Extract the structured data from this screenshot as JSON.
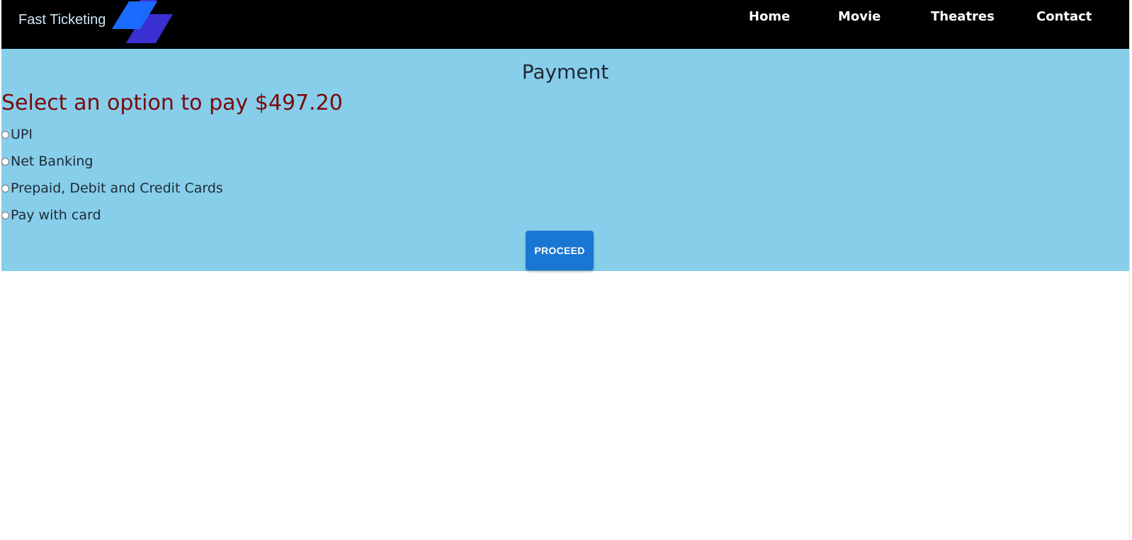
{
  "header": {
    "brand": "Fast Ticketing",
    "nav": {
      "home": "Home",
      "movie": "Movie",
      "theatres": "Theatres",
      "contact": "Contact"
    }
  },
  "payment": {
    "title": "Payment",
    "prompt": "Select an option to pay $497.20",
    "options": [
      {
        "label": "UPI",
        "selected": false
      },
      {
        "label": "Net Banking",
        "selected": false
      },
      {
        "label": "Prepaid, Debit and Credit Cards",
        "selected": false
      },
      {
        "label": "Pay with card",
        "selected": false
      }
    ],
    "proceed_label": "PROCEED"
  },
  "colors": {
    "navbar": "#000000",
    "panel": "#87ceeb",
    "prompt": "#7a0a0a",
    "button": "#1976d2",
    "logo_front": "#1a6cff",
    "logo_back": "#3a2fd1"
  }
}
